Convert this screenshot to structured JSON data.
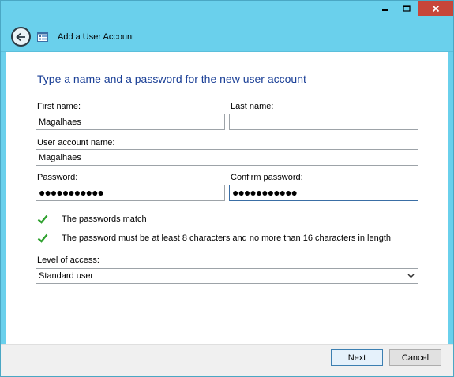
{
  "window": {
    "title": "Add a User Account",
    "caption_buttons": [
      "minimize-icon",
      "maximize-icon",
      "close-icon"
    ],
    "frame_color": "#6ad0ec",
    "close_color": "#c7463a"
  },
  "header": {
    "back_icon": "back-arrow-icon",
    "app_icon": "user-accounts-icon"
  },
  "main": {
    "heading": "Type a name and a password for the new user account",
    "heading_color": "#1a3f96",
    "first_name": {
      "label": "First name:",
      "value": "Magalhaes"
    },
    "last_name": {
      "label": "Last name:",
      "value": ""
    },
    "account_name": {
      "label": "User account name:",
      "value": "Magalhaes"
    },
    "password": {
      "label": "Password:",
      "value": "●●●●●●●●●●●"
    },
    "confirm_password": {
      "label": "Confirm password:",
      "value": "●●●●●●●●●●●"
    },
    "checks": [
      {
        "icon": "checkmark-icon",
        "text": "The passwords match"
      },
      {
        "icon": "checkmark-icon",
        "text": "The password must be at least 8 characters and no more than 16 characters in length"
      }
    ],
    "check_color": "#2fa12f",
    "access": {
      "label": "Level of access:",
      "selected": "Standard user"
    }
  },
  "footer": {
    "next_label": "Next",
    "cancel_label": "Cancel"
  }
}
